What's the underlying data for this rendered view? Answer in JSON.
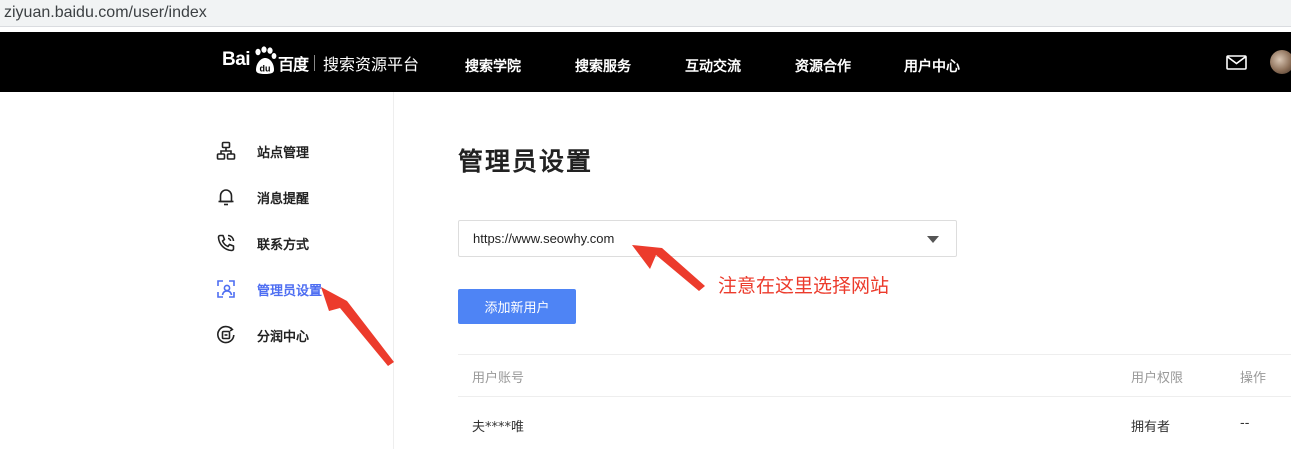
{
  "browser": {
    "url": "ziyuan.baidu.com/user/index"
  },
  "topnav": {
    "logo_bai": "Bai",
    "logo_du": "百度",
    "platform_name": "搜索资源平台",
    "items": [
      {
        "label": "搜索学院"
      },
      {
        "label": "搜索服务"
      },
      {
        "label": "互动交流"
      },
      {
        "label": "资源合作"
      },
      {
        "label": "用户中心"
      }
    ],
    "icons": {
      "mail": "mail-icon",
      "avatar": "avatar"
    }
  },
  "sidebar": {
    "active_color": "#4e6ef2",
    "items": [
      {
        "label": "站点管理",
        "icon": "sitemap-icon"
      },
      {
        "label": "消息提醒",
        "icon": "bell-icon"
      },
      {
        "label": "联系方式",
        "icon": "phone-icon"
      },
      {
        "label": "管理员设置",
        "icon": "admin-user-icon",
        "active": true
      },
      {
        "label": "分润中心",
        "icon": "revenue-share-icon"
      }
    ]
  },
  "main": {
    "title": "管理员设置",
    "site_select": {
      "value": "https://www.seowhy.com",
      "caret_icon": "caret-down-icon"
    },
    "add_user_button": "添加新用户",
    "primary_color": "#4e84f5",
    "table": {
      "headers": [
        "用户账号",
        "用户权限",
        "操作"
      ],
      "rows": [
        {
          "account": "夫****唯",
          "permission": "拥有者",
          "action": "--"
        }
      ]
    }
  },
  "annotation": {
    "text": "注意在这里选择网站",
    "color": "#ec3b2c"
  }
}
